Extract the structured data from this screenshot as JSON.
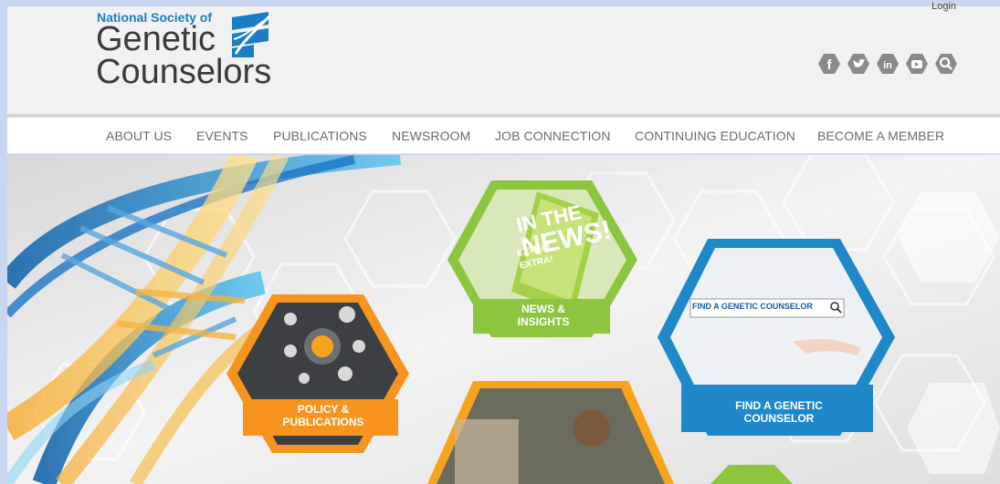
{
  "header": {
    "login": "Login",
    "logo_small": "National Society of",
    "logo_line1": "Genetic",
    "logo_line2": "Counselors"
  },
  "social": [
    "facebook-icon",
    "twitter-icon",
    "linkedin-icon",
    "youtube-icon",
    "search-icon"
  ],
  "nav": {
    "items": [
      {
        "label": "ABOUT US"
      },
      {
        "label": "EVENTS"
      },
      {
        "label": "PUBLICATIONS"
      },
      {
        "label": "NEWSROOM"
      },
      {
        "label": "JOB CONNECTION"
      },
      {
        "label": "CONTINUING EDUCATION"
      },
      {
        "label": "BECOME A MEMBER"
      }
    ]
  },
  "tiles": {
    "news": {
      "title_1": "IN THE",
      "title_2": "NEWS!",
      "extra": "EXTRA! EXTRA!",
      "label": "NEWS & INSIGHTS"
    },
    "policy": {
      "label": "POLICY & PUBLICATIONS"
    },
    "find": {
      "search_text": "FIND A GENETIC COUNSELOR",
      "label": "FIND A GENETIC COUNSELOR"
    }
  },
  "colors": {
    "brand_blue": "#1d7dc3",
    "green": "#8cc63f",
    "orange": "#f7941d",
    "blue_tile": "#1e88c9",
    "nav_text": "#6b6b6b"
  }
}
